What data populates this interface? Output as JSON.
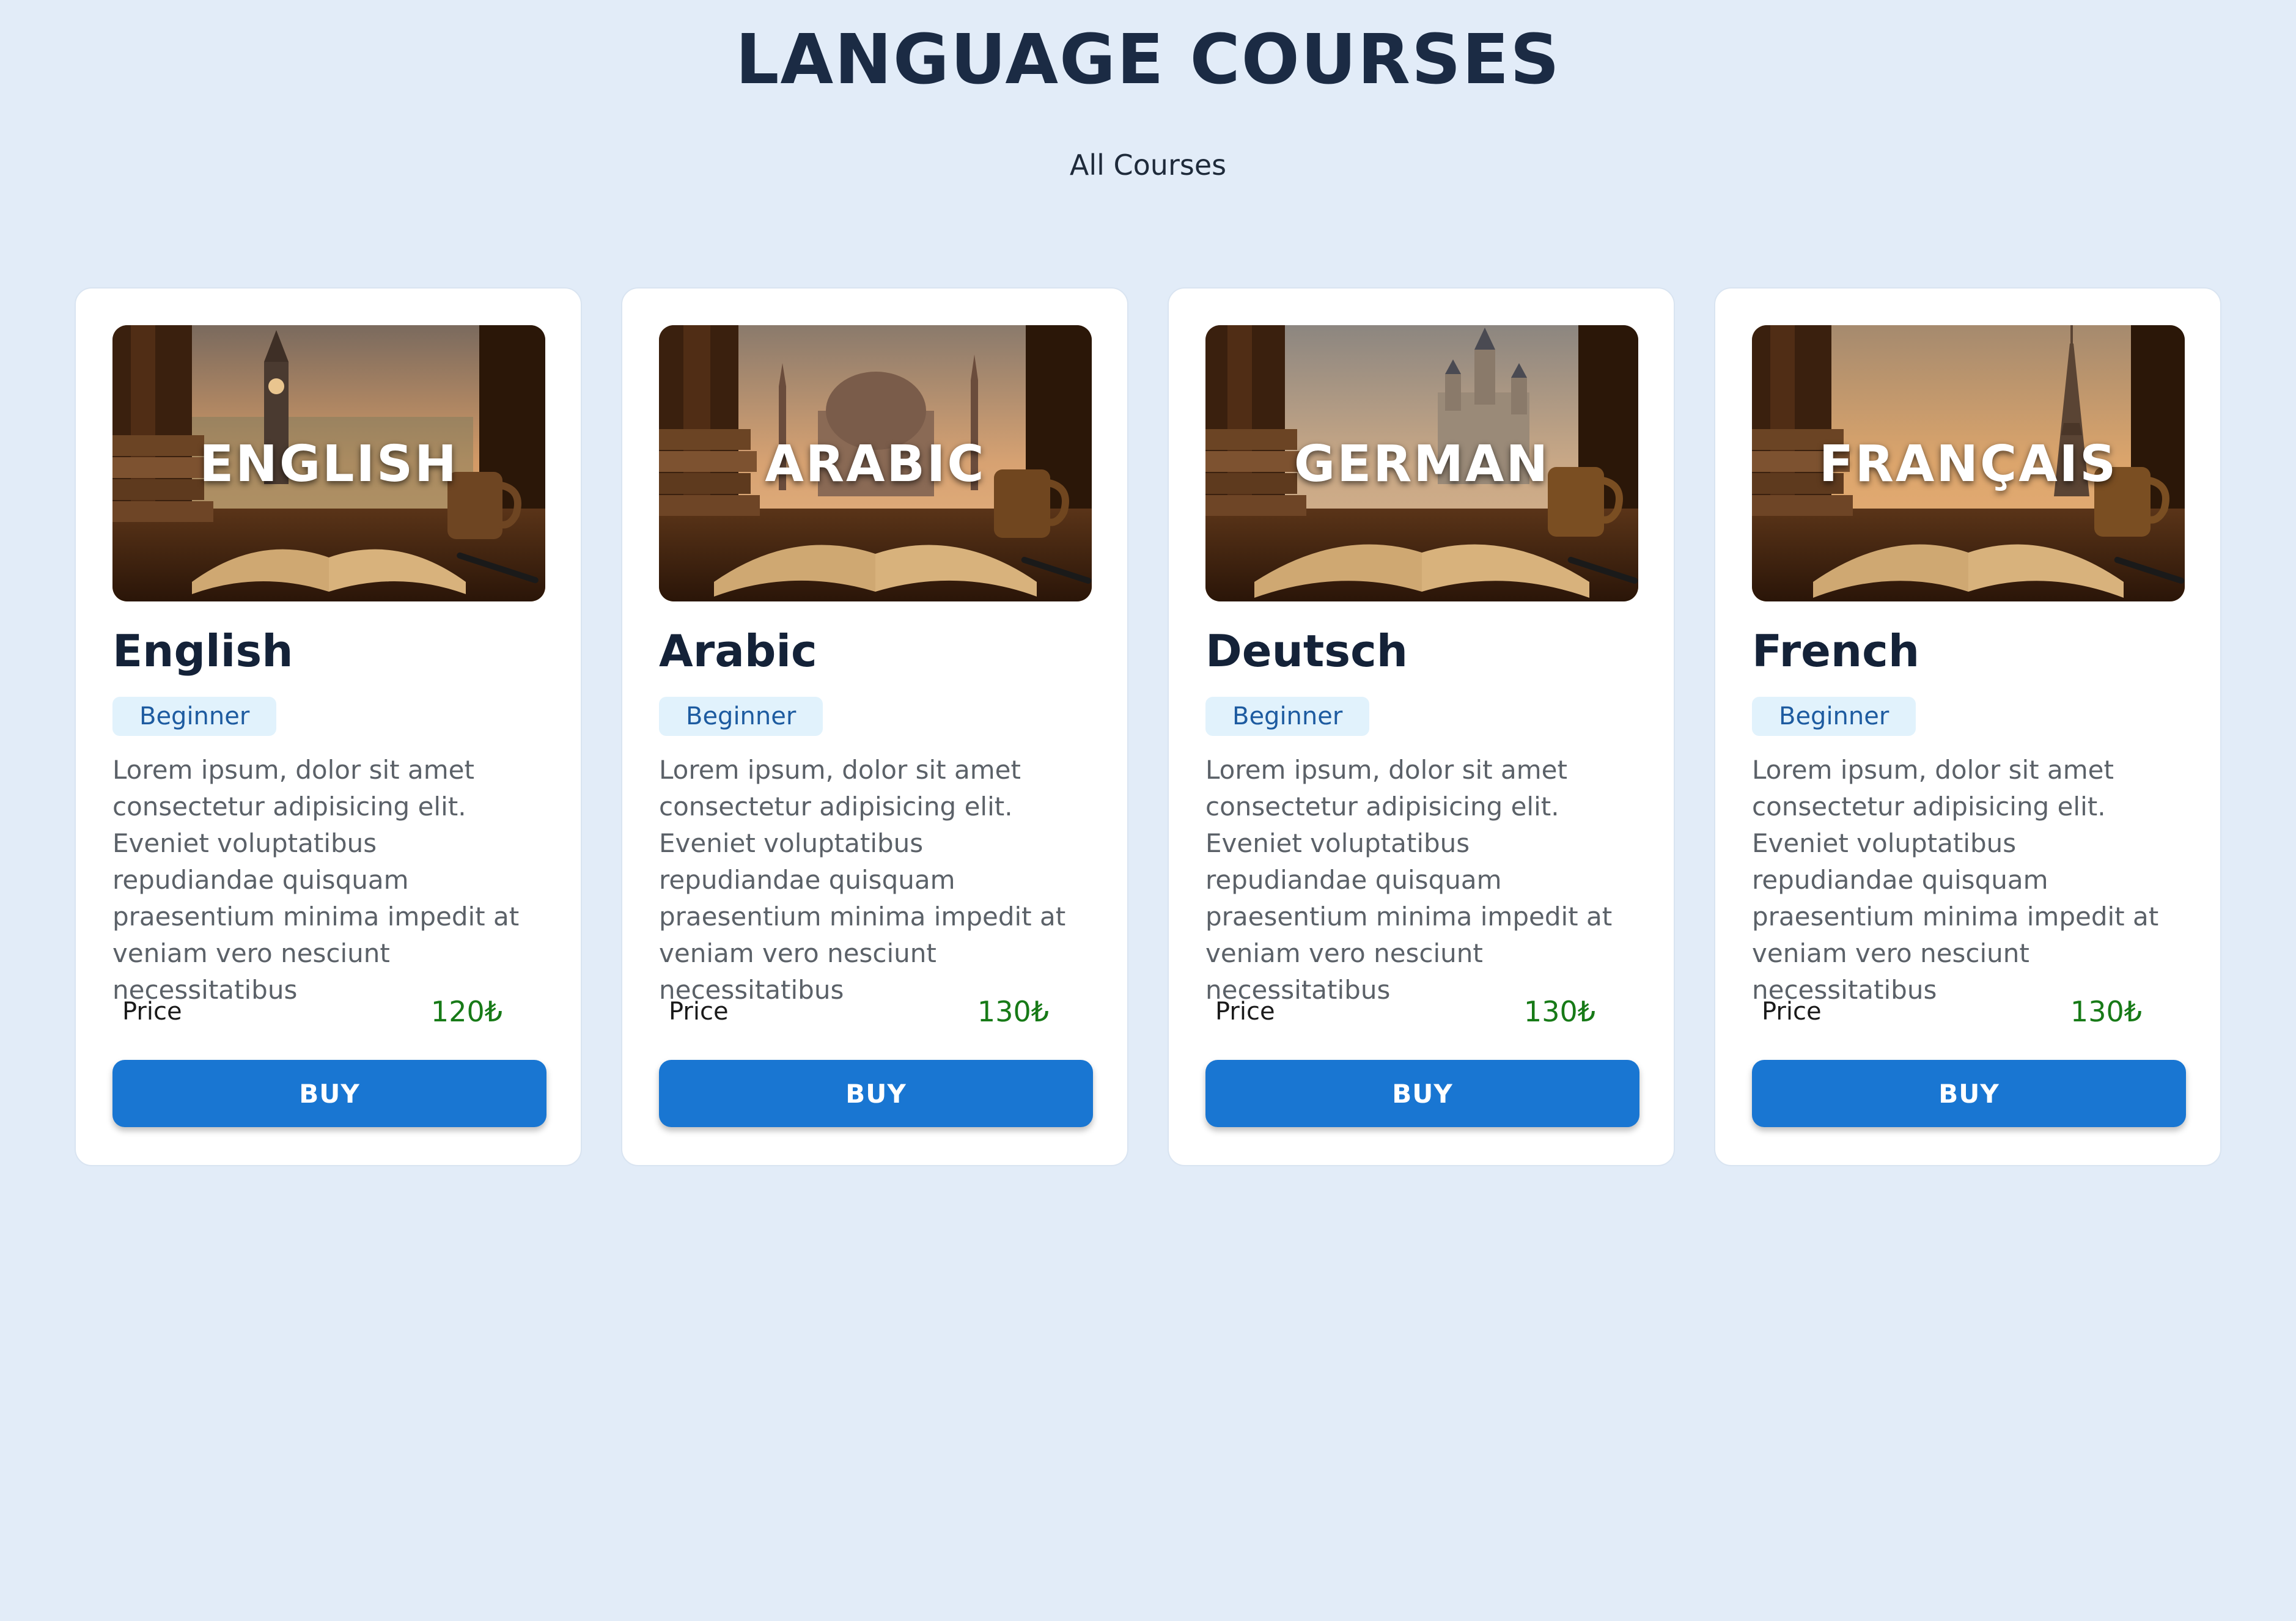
{
  "page": {
    "title": "LANGUAGE COURSES",
    "filter_label": "All Courses"
  },
  "colors": {
    "background": "#e2ecf8",
    "title": "#1b2b44",
    "badge_bg": "#e1f2fc",
    "badge_text": "#1d5ba0",
    "price": "#177a17",
    "button": "#1976d2"
  },
  "price_label": "Price",
  "buy_label": "BUY",
  "courses": [
    {
      "image_text": "ENGLISH",
      "landmark": "clock-tower",
      "name": "English",
      "level": "Beginner",
      "description": "Lorem ipsum, dolor sit amet consectetur adipisicing elit. Eveniet voluptatibus repudiandae quisquam praesentium minima impedit at veniam vero nesciunt necessitatibus",
      "price": "120₺"
    },
    {
      "image_text": "ARABIC",
      "landmark": "mosque-dome",
      "name": "Arabic",
      "level": "Beginner",
      "description": "Lorem ipsum, dolor sit amet consectetur adipisicing elit. Eveniet voluptatibus repudiandae quisquam praesentium minima impedit at veniam vero nesciunt necessitatibus",
      "price": "130₺"
    },
    {
      "image_text": "GERMAN",
      "landmark": "castle",
      "name": "Deutsch",
      "level": "Beginner",
      "description": "Lorem ipsum, dolor sit amet consectetur adipisicing elit. Eveniet voluptatibus repudiandae quisquam praesentium minima impedit at veniam vero nesciunt necessitatibus",
      "price": "130₺"
    },
    {
      "image_text": "FRANÇAIS",
      "landmark": "eiffel-tower",
      "name": "French",
      "level": "Beginner",
      "description": "Lorem ipsum, dolor sit amet consectetur adipisicing elit. Eveniet voluptatibus repudiandae quisquam praesentium minima impedit at veniam vero nesciunt necessitatibus",
      "price": "130₺"
    }
  ]
}
